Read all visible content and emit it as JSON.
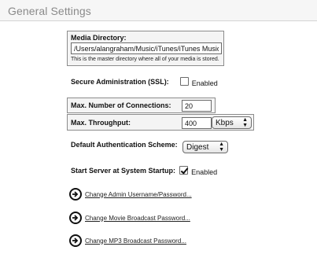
{
  "page": {
    "title": "General Settings"
  },
  "media": {
    "label": "Media Directory:",
    "value": "/Users/alangraham/Music/iTunes/iTunes Music",
    "description": "This is the master directory where all of your media is stored."
  },
  "ssl": {
    "label": "Secure Administration (SSL):",
    "checkbox_label": "Enabled",
    "checked": false
  },
  "connections": {
    "label": "Max. Number of Connections:",
    "value": "20"
  },
  "throughput": {
    "label": "Max. Throughput:",
    "value": "400",
    "unit": "Kbps"
  },
  "auth": {
    "label": "Default Authentication Scheme:",
    "value": "Digest"
  },
  "startup": {
    "label": "Start Server at System Startup:",
    "checkbox_label": "Enabled",
    "checked": true
  },
  "links": [
    {
      "label": "Change Admin Username/Password...",
      "icon": "arrow-right-icon"
    },
    {
      "label": "Change Movie Broadcast Password...",
      "icon": "arrow-right-icon"
    },
    {
      "label": "Change MP3 Broadcast Password...",
      "icon": "arrow-right-icon"
    }
  ]
}
